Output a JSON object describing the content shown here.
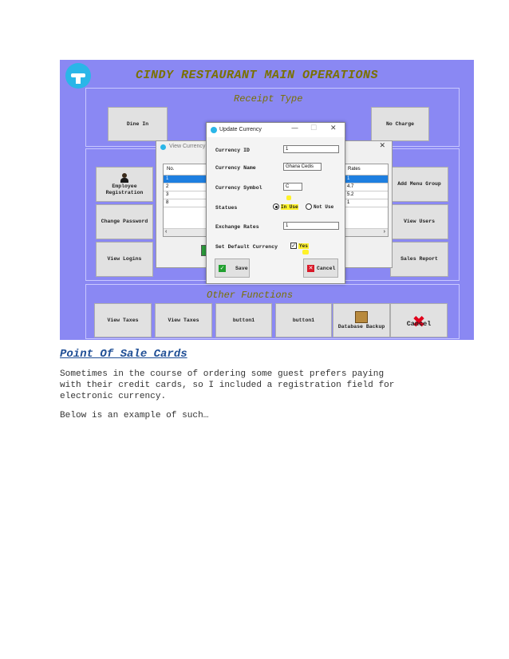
{
  "screenshot": {
    "title": "CINDY RESTAURANT MAIN OPERATIONS",
    "receipt_group_title": "Receipt Type",
    "other_group_title": "Other Functions",
    "receipt_buttons": [
      "Dine In",
      "No Charge"
    ],
    "left_buttons": {
      "employee": "Employee\nRegistration",
      "change_password": "Change Password",
      "view_logins": "View Logins"
    },
    "right_buttons": {
      "add_menu_group": "Add Menu Group",
      "view_users": "View Users",
      "sales_report": "Sales Report"
    },
    "bottom_buttons": [
      "View Taxes",
      "View Taxes",
      "button1",
      "button1",
      "Database Backup",
      "Cancel"
    ],
    "view_currency": {
      "title": "View Currency",
      "left_header": "No.",
      "left_rows": [
        "1",
        "2",
        "3",
        "8"
      ],
      "right_header": "Rates",
      "right_rows": [
        "1",
        "4.7",
        "5.2",
        "1"
      ]
    },
    "update_currency": {
      "title": "Update Currency",
      "currency_id_label": "Currency ID",
      "currency_id": "1",
      "currency_name_label": "Currency Name",
      "currency_name": "Ghana Cedis",
      "currency_symbol_label": "Currency Symbol",
      "currency_symbol": "C",
      "status_label": "Statues",
      "status_in_use": "In Use",
      "status_not_use": "Not Use",
      "exchange_rates_label": "Exchange Rates",
      "exchange_rate": "1",
      "default_currency_label": "Set Default Currency",
      "default_currency_value": "Yes",
      "save_label": "Save",
      "cancel_label": "Cancel"
    },
    "colors": {
      "background": "#8a88f3",
      "title": "#7a7100",
      "highlight": "#fff22a"
    }
  },
  "document": {
    "heading": "Point Of Sale Cards",
    "paragraph1_line1": "Sometimes in the course of ordering some guest prefers paying",
    "paragraph1_line2": "with their credit cards, so I included a registration field for",
    "paragraph1_line3": "electronic currency.",
    "paragraph2": "Below is an example of such…",
    "heading_color": "#1f4e95"
  }
}
